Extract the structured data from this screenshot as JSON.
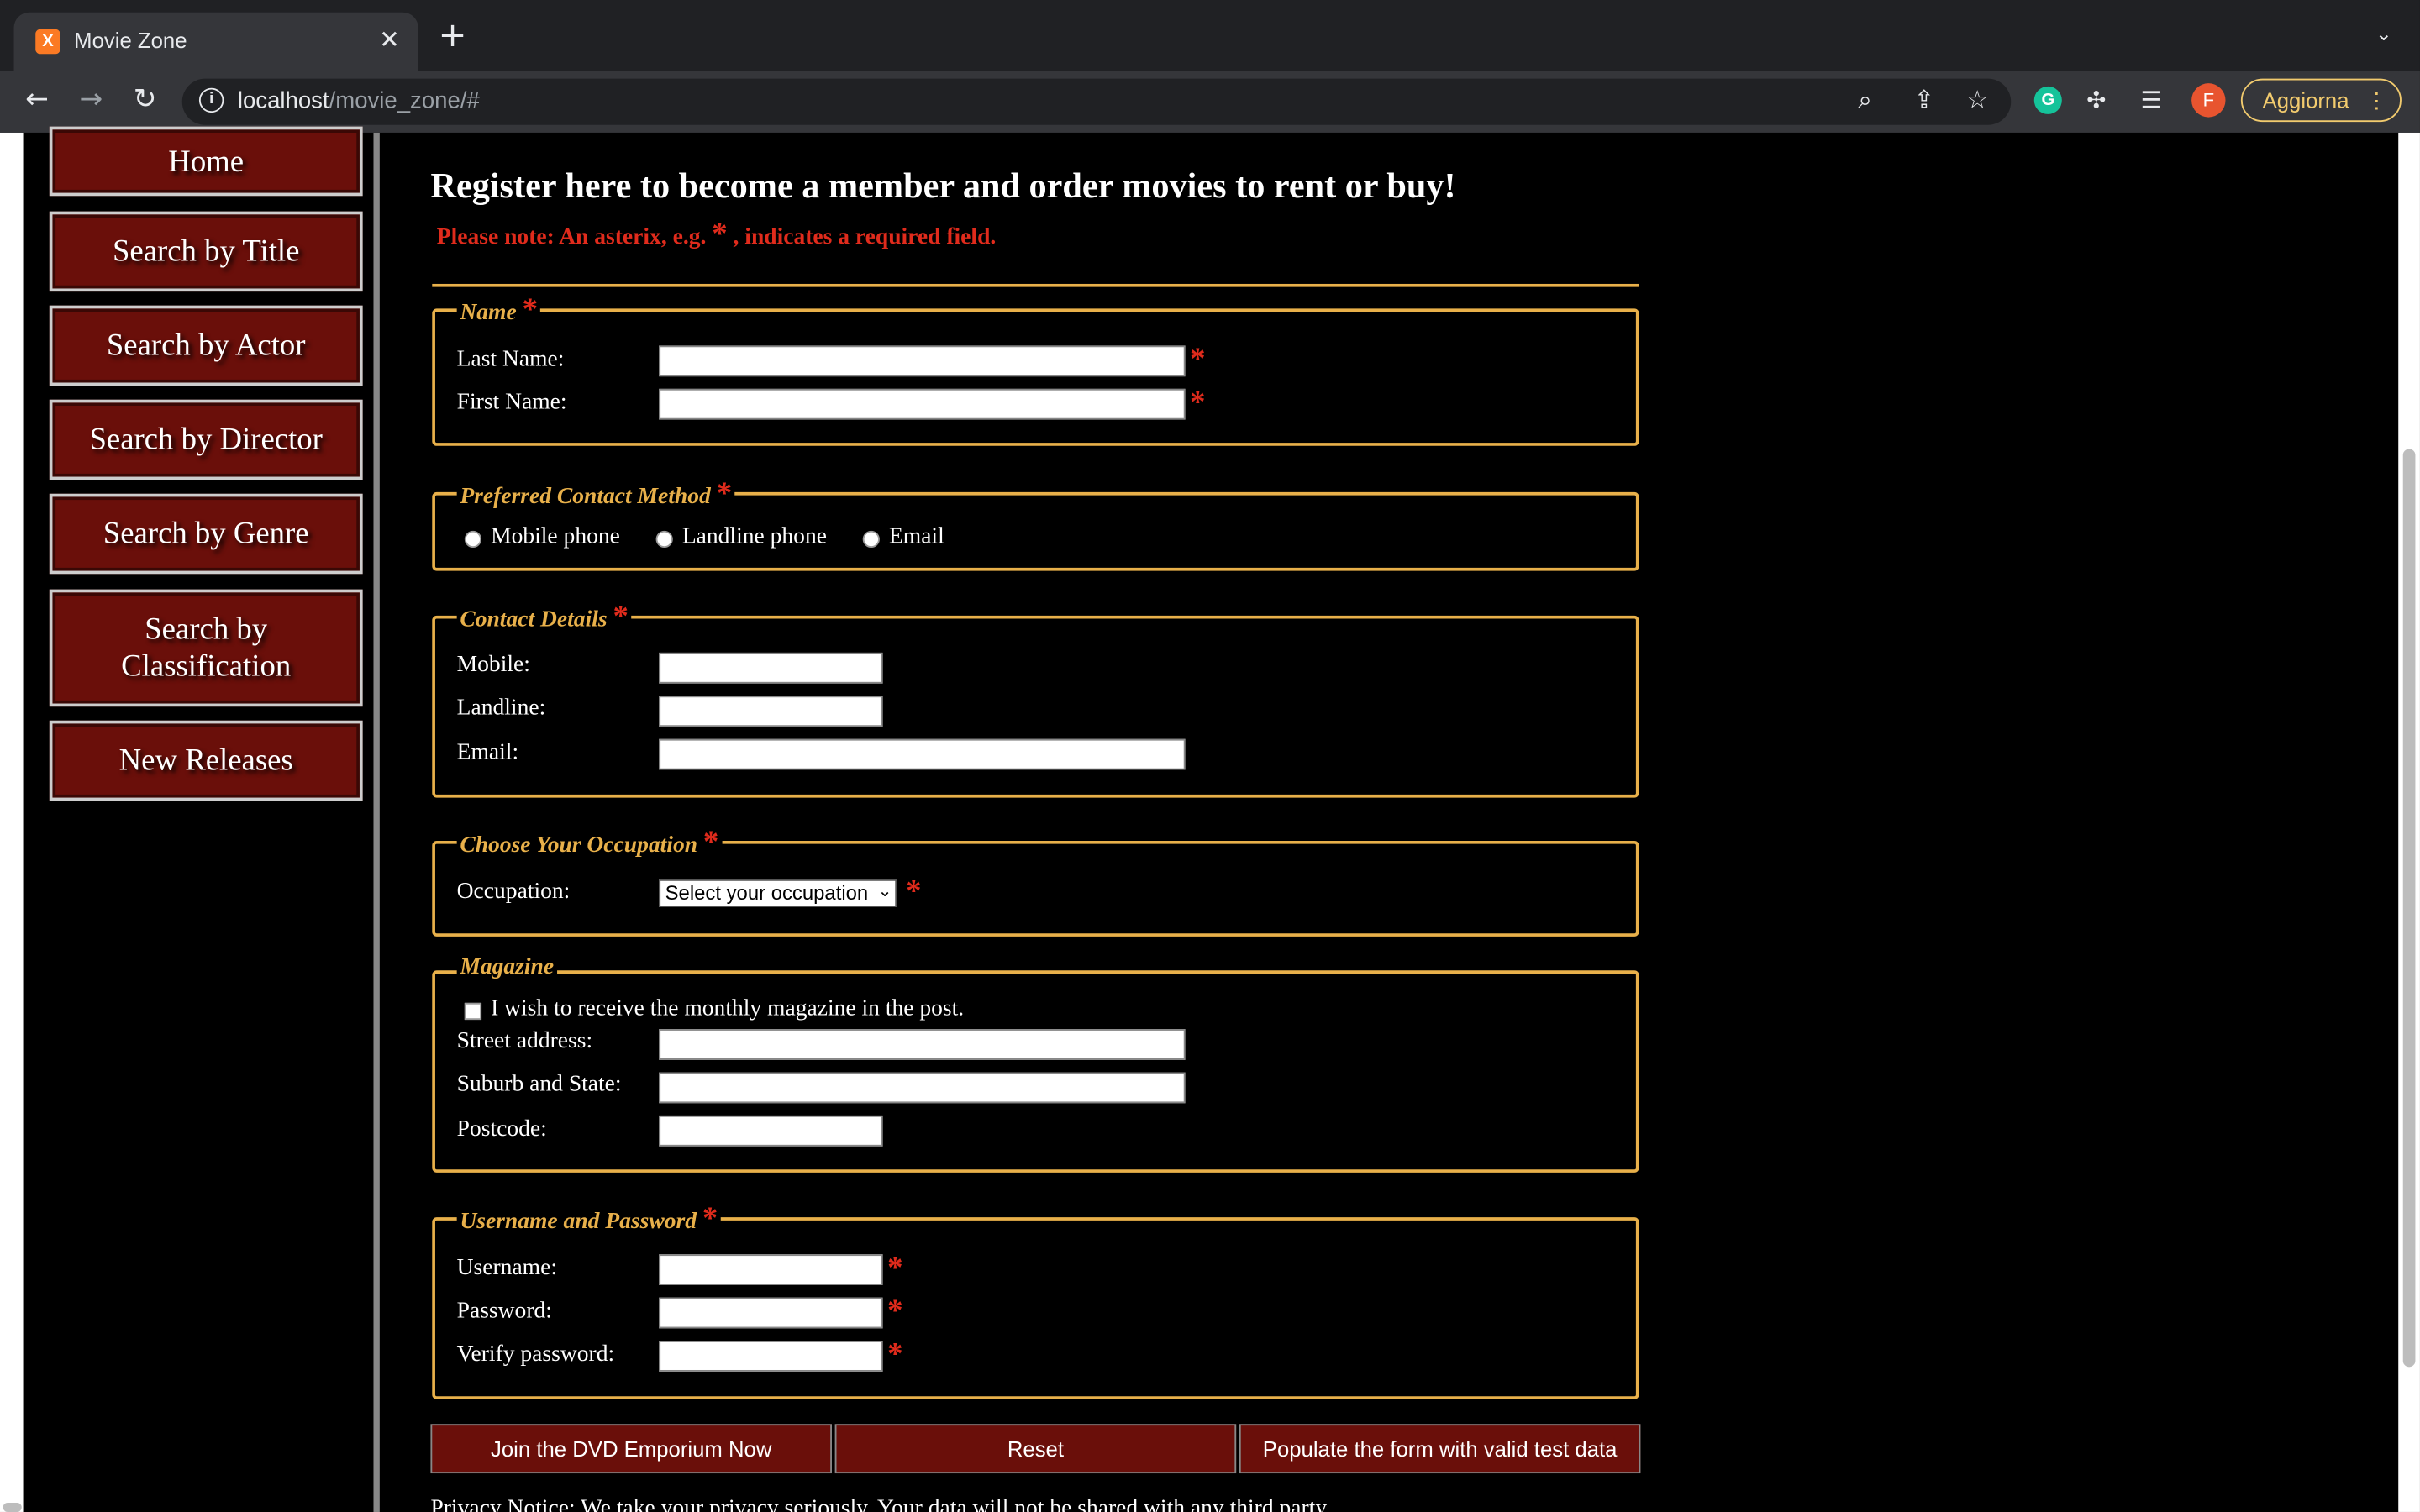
{
  "browser": {
    "tab_title": "Movie Zone",
    "tab_favicon": "xampp-icon",
    "url_host": "localhost",
    "url_path": "/movie_zone/#",
    "avatar_letter": "F",
    "update_label": "Aggiorna"
  },
  "sidebar": {
    "items": [
      {
        "label": "Home"
      },
      {
        "label": "Search by Title"
      },
      {
        "label": "Search by Actor"
      },
      {
        "label": "Search by Director"
      },
      {
        "label": "Search by Genre"
      },
      {
        "label": "Search by Classification"
      },
      {
        "label": "New Releases"
      }
    ]
  },
  "main": {
    "heading": "Register here to become a member and order movies to rent or buy!",
    "note_prefix": "Please note: An asterix, e.g.",
    "note_suffix": ", indicates a required field.",
    "asterisk": "*"
  },
  "form": {
    "name": {
      "legend": "Name",
      "last_name_label": "Last Name:",
      "first_name_label": "First Name:"
    },
    "contact_method": {
      "legend": "Preferred Contact Method",
      "options": [
        "Mobile phone",
        "Landline phone",
        "Email"
      ]
    },
    "contact_details": {
      "legend": "Contact Details",
      "mobile_label": "Mobile:",
      "landline_label": "Landline:",
      "email_label": "Email:"
    },
    "occupation": {
      "legend": "Choose Your Occupation",
      "label": "Occupation:",
      "selected": "Select your occupation"
    },
    "magazine": {
      "legend": "Magazine",
      "checkbox_label": "I wish to receive the monthly magazine in the post.",
      "street_label": "Street address:",
      "suburb_label": "Suburb and State:",
      "postcode_label": "Postcode:"
    },
    "credentials": {
      "legend": "Username and Password",
      "username_label": "Username:",
      "password_label": "Password:",
      "verify_label": "Verify password:"
    },
    "buttons": {
      "join": "Join the DVD Emporium Now",
      "reset": "Reset",
      "populate": "Populate the form with valid test data"
    },
    "privacy": "Privacy Notice: We take your privacy seriously. Your data will not be shared with any third party."
  }
}
